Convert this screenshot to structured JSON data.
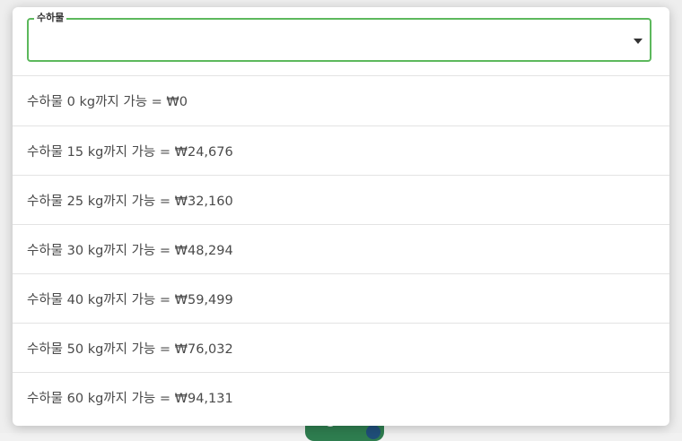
{
  "select": {
    "label": "수하물",
    "value": "",
    "caret_icon": "caret-down-icon"
  },
  "options": [
    {
      "label": "수하물 0 kg까지 가능 = ₩0"
    },
    {
      "label": "수하물 15 kg까지 가능 = ₩24,676"
    },
    {
      "label": "수하물 25 kg까지 가능 = ₩32,160"
    },
    {
      "label": "수하물 30 kg까지 가능 = ₩48,294"
    },
    {
      "label": "수하물 40 kg까지 가능 = ₩59,499"
    },
    {
      "label": "수하물 50 kg까지 가능 = ₩76,032"
    },
    {
      "label": "수하물 60 kg까지 가능 = ₩94,131"
    }
  ],
  "colors": {
    "accent": "#5cb85c",
    "text": "#4a4a4a",
    "divider": "#e3e3e3"
  }
}
